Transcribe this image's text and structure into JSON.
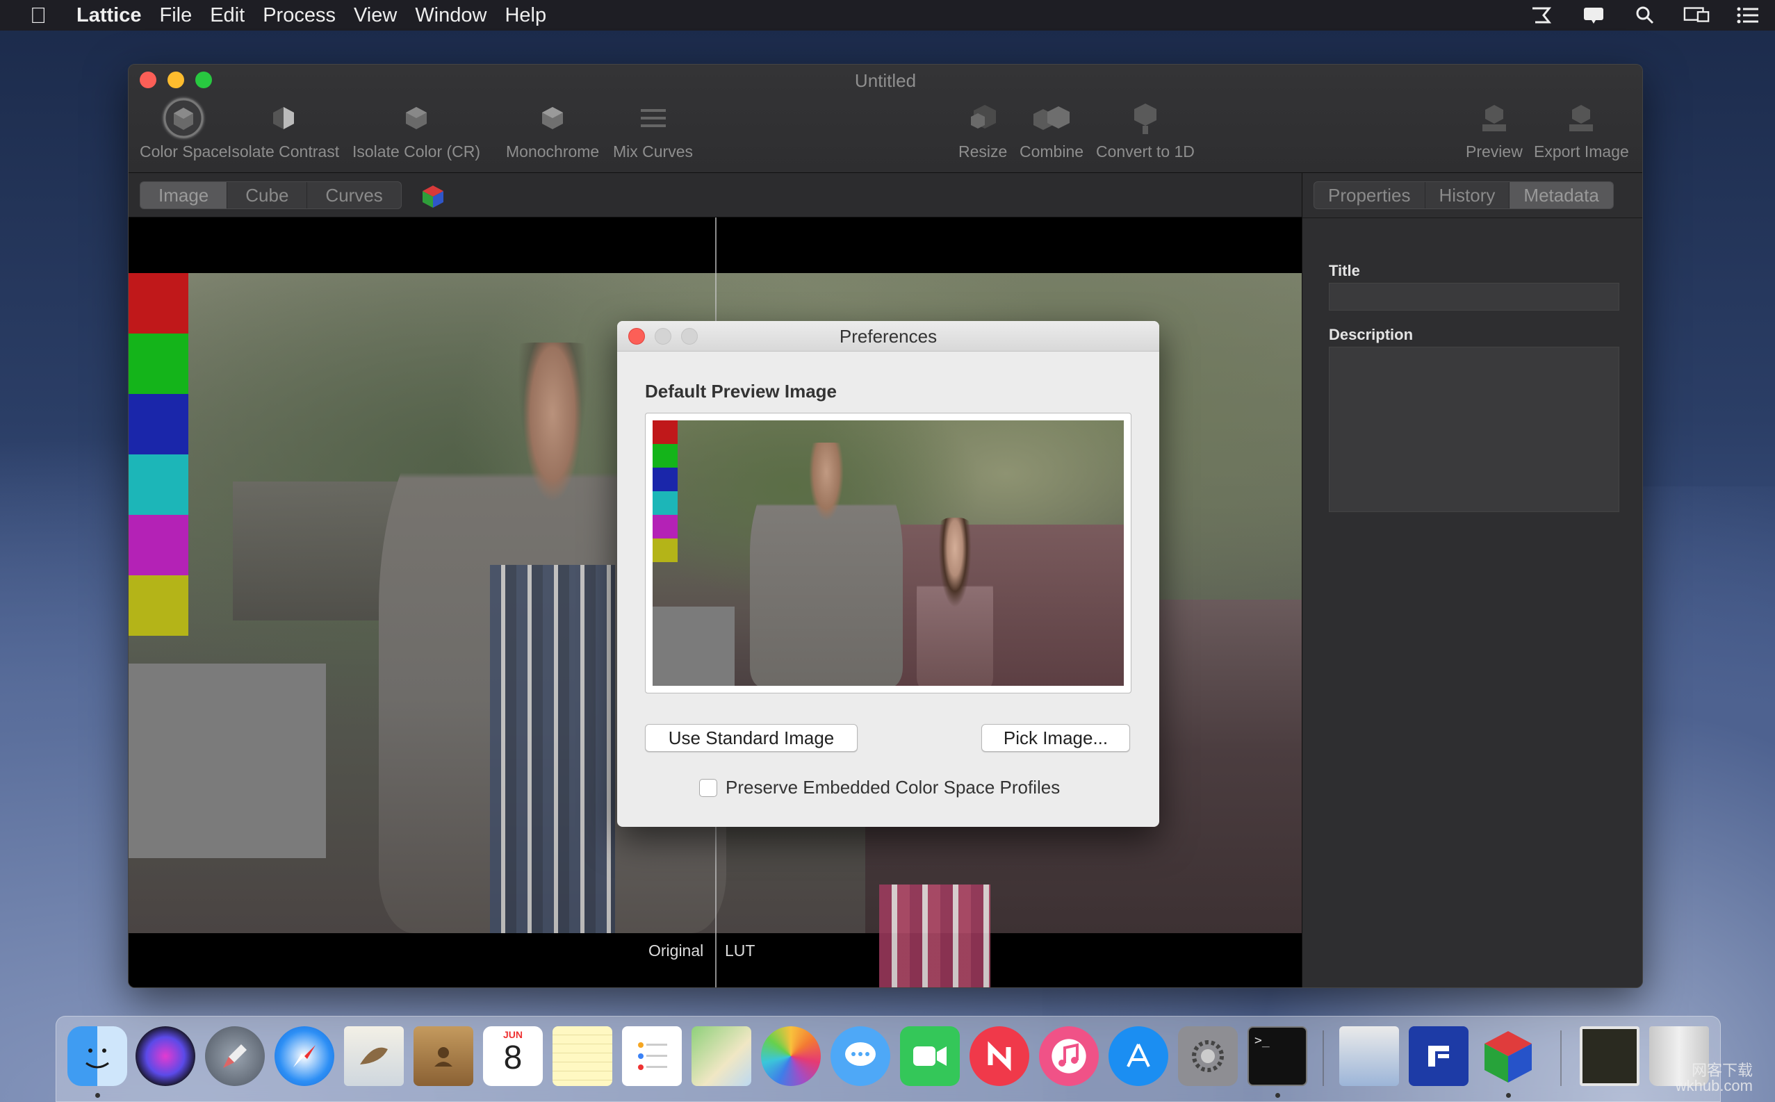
{
  "menubar": {
    "app_name": "Lattice",
    "items": [
      "File",
      "Edit",
      "Process",
      "View",
      "Window",
      "Help"
    ]
  },
  "window": {
    "title": "Untitled",
    "toolbar": [
      {
        "label": "Color Space",
        "icon": "color-space-icon"
      },
      {
        "label": "Isolate Contrast",
        "icon": "isolate-contrast-icon"
      },
      {
        "label": "Isolate Color (CR)",
        "icon": "isolate-color-icon"
      },
      {
        "label": "Monochrome",
        "icon": "monochrome-icon"
      },
      {
        "label": "Mix Curves",
        "icon": "mix-curves-icon"
      },
      {
        "label": "Resize",
        "icon": "resize-icon"
      },
      {
        "label": "Combine",
        "icon": "combine-icon"
      },
      {
        "label": "Convert to 1D",
        "icon": "convert-1d-icon"
      },
      {
        "label": "Preview",
        "icon": "preview-icon"
      },
      {
        "label": "Export Image",
        "icon": "export-image-icon"
      }
    ],
    "view_tabs": [
      "Image",
      "Cube",
      "Curves"
    ],
    "active_view_tab": "Image",
    "viewer": {
      "left_label": "Original",
      "right_label": "LUT"
    },
    "swatches": [
      "#c0181a",
      "#14b41a",
      "#1a26aa",
      "#1cb6b8",
      "#b422b6",
      "#b4b418"
    ],
    "panel_tabs": [
      "Properties",
      "History",
      "Metadata"
    ],
    "active_panel_tab": "Metadata",
    "metadata": {
      "title_label": "Title",
      "title_value": "",
      "description_label": "Description",
      "description_value": ""
    }
  },
  "preferences": {
    "title": "Preferences",
    "heading": "Default Preview Image",
    "use_standard_button": "Use Standard Image",
    "pick_image_button": "Pick Image...",
    "preserve_checkbox_label": "Preserve Embedded Color Space Profiles",
    "preserve_checked": false
  },
  "dock": {
    "apps": [
      "finder",
      "siri",
      "launchpad",
      "safari",
      "mail",
      "contacts",
      "calendar",
      "notes",
      "reminders",
      "maps",
      "photos",
      "messages",
      "facetime",
      "news",
      "itunes",
      "app-store",
      "system-preferences",
      "terminal",
      "preview",
      "lattice-docs",
      "lattice",
      "downloads",
      "trash"
    ],
    "calendar_month": "JUN",
    "calendar_day": "8"
  },
  "watermark": {
    "line1": "网客下载",
    "line2": "wkhub.com"
  }
}
